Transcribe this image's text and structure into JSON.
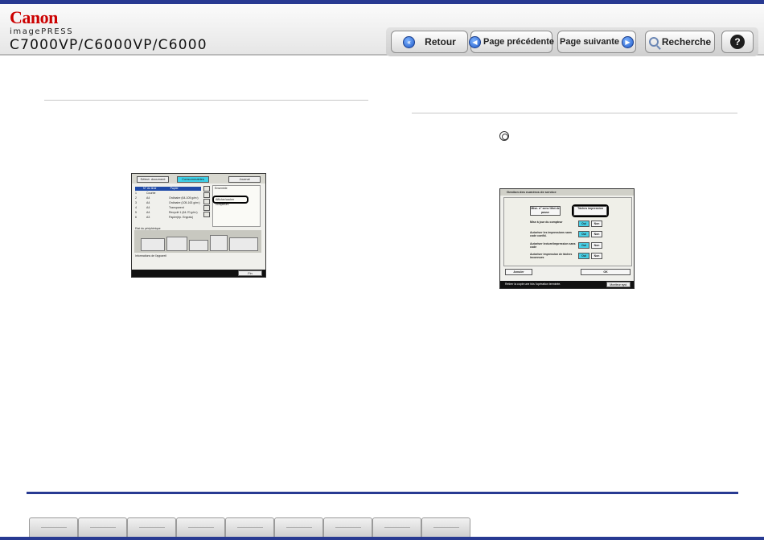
{
  "header": {
    "brand": "Canon",
    "product_line": "imagePRESS",
    "model": "C7000VP/C6000VP/C6000"
  },
  "nav": {
    "back": "Retour",
    "previous": "Page précédente",
    "next": "Page suivante",
    "search": "Recherche",
    "help": "?"
  },
  "left_screenshot": {
    "tabs": [
      "Sélect. document",
      "Consommables",
      "Journal"
    ],
    "list_header": [
      "N° du tiroir",
      "Papier"
    ],
    "rows": [
      [
        "1",
        "Courbe",
        ""
      ],
      [
        "2",
        "A4",
        "Ordinaire (64-105 g/m²)"
      ],
      [
        "3",
        "A4",
        "Ordinaire (105-163 g/m²)"
      ],
      [
        "4",
        "A4",
        "Transparent"
      ],
      [
        "5",
        "A4",
        "Recyclé 1 (64-70 g/m²)"
      ],
      [
        "6",
        "A3",
        "Papier(ép. Engrais)"
      ]
    ],
    "panel_title": "Ensemble",
    "highlight_button": "Afficher/cacher compteurs",
    "machine_label": "Etat du périphérique",
    "status_label": "Informations de l'appareil",
    "finish_button": "Fin"
  },
  "right_screenshot": {
    "title": "Gestion des numéros de service",
    "options": [
      {
        "label": "Mise à jour du compteur",
        "on": "Oui",
        "off": "Non"
      },
      {
        "label": "Autoriser les impressions sans code confid.",
        "on": "Oui",
        "off": "Non"
      },
      {
        "label": "Autoriser lecture/impression sans code",
        "on": "Oui",
        "off": "Non"
      },
      {
        "label": "Autoriser impression de tâches inconnues",
        "on": "Oui",
        "off": "Non"
      }
    ],
    "top_button_left": "Mise. n° serv./ Mot de passe",
    "top_button_right": "Tâches impression",
    "cancel": "Annuler",
    "ok": "OK",
    "status": "Retirer la copie une fois l'opération terminée.",
    "monitor": "Moniteur syst."
  },
  "footer_tabs": [
    "",
    "",
    "",
    "",
    "",
    "",
    "",
    "",
    ""
  ],
  "colors": {
    "accent_blue": "#283a92",
    "highlight_cyan": "#47cfe6"
  }
}
